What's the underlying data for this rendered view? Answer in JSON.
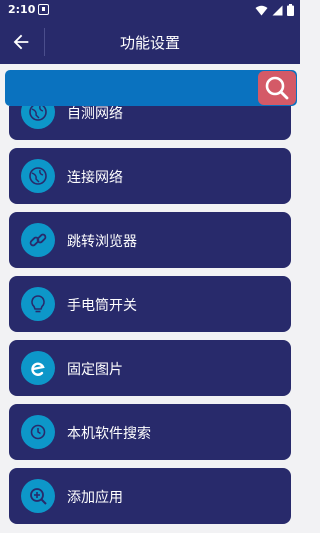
{
  "status": {
    "time": "2:10"
  },
  "appbar": {
    "title": "功能设置"
  },
  "list": {
    "items": [
      {
        "label": "自测网络",
        "icon": "globe-icon"
      },
      {
        "label": "连接网络",
        "icon": "globe-icon"
      },
      {
        "label": "跳转浏览器",
        "icon": "link-icon"
      },
      {
        "label": "手电筒开关",
        "icon": "bulb-icon"
      },
      {
        "label": "固定图片",
        "icon": "e-icon"
      },
      {
        "label": "本机软件搜索",
        "icon": "clock-search-icon"
      },
      {
        "label": "添加应用",
        "icon": "zoom-in-icon"
      }
    ]
  },
  "colors": {
    "primary": "#282a6b",
    "search_bar": "#0a72bf",
    "search_button": "#d45a67",
    "icon_circle": "#0d97c9",
    "background": "#f2f2f4"
  }
}
